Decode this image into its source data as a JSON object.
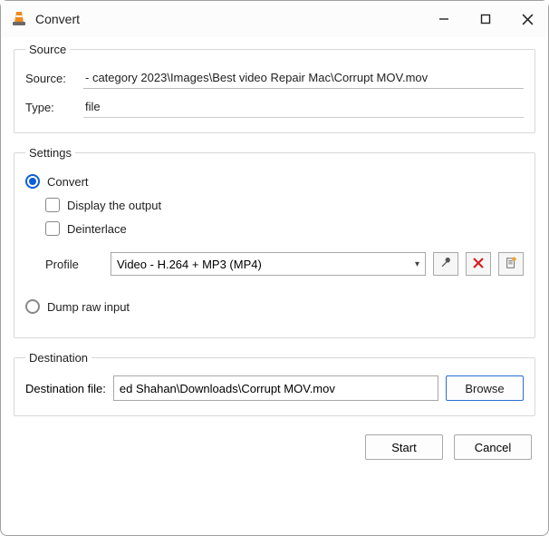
{
  "window": {
    "title": "Convert"
  },
  "source": {
    "legend": "Source",
    "source_label": "Source:",
    "source_value": " - category 2023\\Images\\Best video Repair Mac\\Corrupt MOV.mov",
    "type_label": "Type:",
    "type_value": "file"
  },
  "settings": {
    "legend": "Settings",
    "convert_label": "Convert",
    "display_output_label": "Display the output",
    "deinterlace_label": "Deinterlace",
    "profile_label": "Profile",
    "profile_value": "Video - H.264 + MP3 (MP4)",
    "dump_raw_label": "Dump raw input"
  },
  "destination": {
    "legend": "Destination",
    "file_label": "Destination file:",
    "file_value": "ed Shahan\\Downloads\\Corrupt MOV.mov",
    "browse_label": "Browse"
  },
  "buttons": {
    "start": "Start",
    "cancel": "Cancel"
  }
}
